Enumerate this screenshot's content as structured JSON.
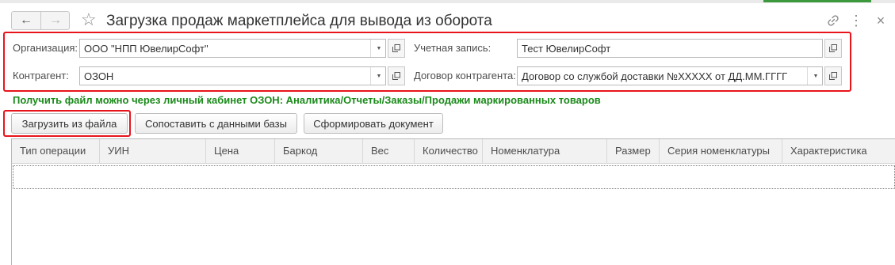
{
  "window": {
    "title": "Загрузка продаж маркетплейса для вывода из оборота",
    "nav_back": "←",
    "nav_forward": "→",
    "favorite": "☆",
    "icons": {
      "link": "link-icon",
      "more": "⋮",
      "close": "×"
    }
  },
  "form": {
    "organization": {
      "label": "Организация:",
      "value": "ООО \"НПП ЮвелирСофт\""
    },
    "contractor": {
      "label": "Контрагент:",
      "value": "ОЗОН"
    },
    "account": {
      "label": "Учетная запись:",
      "value": "Тест ЮвелирСофт"
    },
    "contract": {
      "label": "Договор контрагента:",
      "value": "Договор со службой доставки №XXXXX от ДД.ММ.ГГГГ"
    }
  },
  "hint": "Получить файл можно через личный кабинет ОЗОН: Аналитика/Отчеты/Заказы/Продажи маркированных товаров",
  "toolbar": {
    "load_from_file": "Загрузить из файла",
    "match_db": "Сопоставить с данными базы",
    "create_doc": "Сформировать документ"
  },
  "table": {
    "columns": [
      "Тип операции",
      "УИН",
      "Цена",
      "Баркод",
      "Вес",
      "Количество",
      "Номенклатура",
      "Размер",
      "Серия номенклатуры",
      "Характеристика"
    ],
    "rows": []
  },
  "colors": {
    "highlight": "#e8141b",
    "hint": "#1a8a1a",
    "accent": "#3c9a3c"
  }
}
